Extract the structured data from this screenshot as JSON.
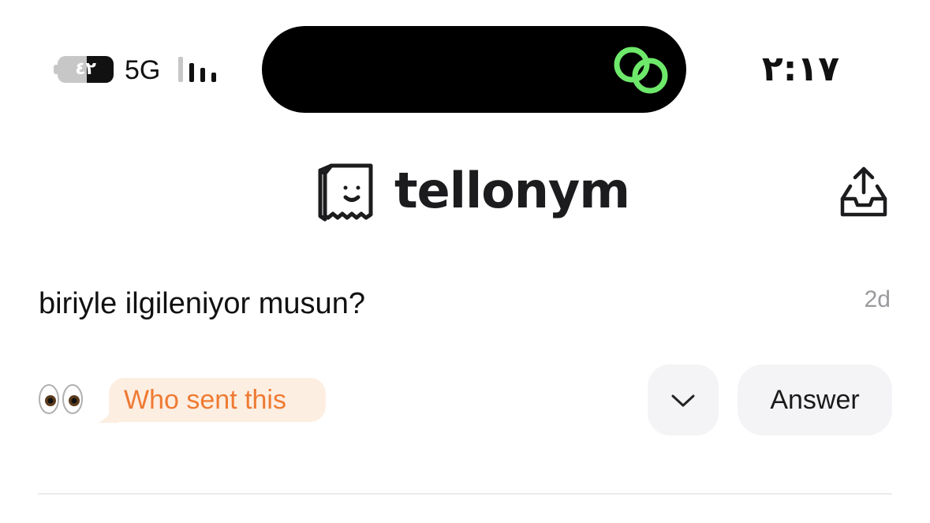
{
  "status_bar": {
    "battery_level": "٤٢",
    "network": "5G",
    "signal_bars": 3,
    "time": "٢:١٧",
    "island_icon": "link-icon",
    "island_icon_color": "#6ee86a"
  },
  "header": {
    "app_name": "tellonym",
    "logo_icon": "paper-bag-face-icon",
    "action_icon": "inbox-share-icon"
  },
  "message": {
    "question": "biriyle ilgileniyor musun?",
    "age": "2d",
    "reaction_icon": "eyes-emoji-icon",
    "sender_label": "Who sent this",
    "sender_color": "#ee7b33",
    "answer_label": "Answer",
    "expand_icon": "chevron-down-icon"
  }
}
